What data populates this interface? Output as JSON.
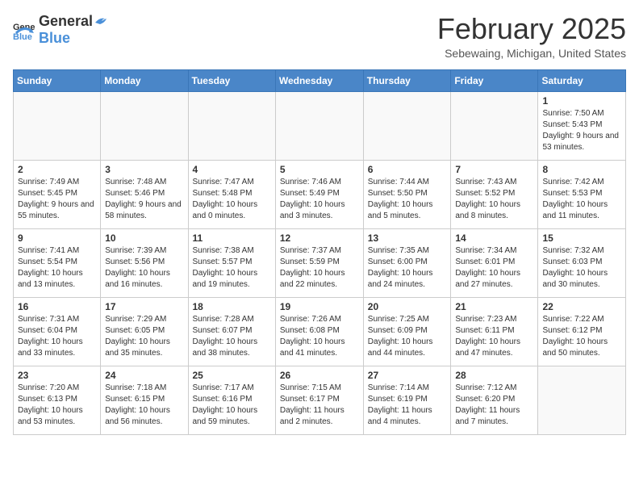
{
  "header": {
    "logo_general": "General",
    "logo_blue": "Blue",
    "title": "February 2025",
    "subtitle": "Sebewaing, Michigan, United States"
  },
  "columns": [
    "Sunday",
    "Monday",
    "Tuesday",
    "Wednesday",
    "Thursday",
    "Friday",
    "Saturday"
  ],
  "weeks": [
    [
      {
        "day": "",
        "info": ""
      },
      {
        "day": "",
        "info": ""
      },
      {
        "day": "",
        "info": ""
      },
      {
        "day": "",
        "info": ""
      },
      {
        "day": "",
        "info": ""
      },
      {
        "day": "",
        "info": ""
      },
      {
        "day": "1",
        "info": "Sunrise: 7:50 AM\nSunset: 5:43 PM\nDaylight: 9 hours and 53 minutes."
      }
    ],
    [
      {
        "day": "2",
        "info": "Sunrise: 7:49 AM\nSunset: 5:45 PM\nDaylight: 9 hours and 55 minutes."
      },
      {
        "day": "3",
        "info": "Sunrise: 7:48 AM\nSunset: 5:46 PM\nDaylight: 9 hours and 58 minutes."
      },
      {
        "day": "4",
        "info": "Sunrise: 7:47 AM\nSunset: 5:48 PM\nDaylight: 10 hours and 0 minutes."
      },
      {
        "day": "5",
        "info": "Sunrise: 7:46 AM\nSunset: 5:49 PM\nDaylight: 10 hours and 3 minutes."
      },
      {
        "day": "6",
        "info": "Sunrise: 7:44 AM\nSunset: 5:50 PM\nDaylight: 10 hours and 5 minutes."
      },
      {
        "day": "7",
        "info": "Sunrise: 7:43 AM\nSunset: 5:52 PM\nDaylight: 10 hours and 8 minutes."
      },
      {
        "day": "8",
        "info": "Sunrise: 7:42 AM\nSunset: 5:53 PM\nDaylight: 10 hours and 11 minutes."
      }
    ],
    [
      {
        "day": "9",
        "info": "Sunrise: 7:41 AM\nSunset: 5:54 PM\nDaylight: 10 hours and 13 minutes."
      },
      {
        "day": "10",
        "info": "Sunrise: 7:39 AM\nSunset: 5:56 PM\nDaylight: 10 hours and 16 minutes."
      },
      {
        "day": "11",
        "info": "Sunrise: 7:38 AM\nSunset: 5:57 PM\nDaylight: 10 hours and 19 minutes."
      },
      {
        "day": "12",
        "info": "Sunrise: 7:37 AM\nSunset: 5:59 PM\nDaylight: 10 hours and 22 minutes."
      },
      {
        "day": "13",
        "info": "Sunrise: 7:35 AM\nSunset: 6:00 PM\nDaylight: 10 hours and 24 minutes."
      },
      {
        "day": "14",
        "info": "Sunrise: 7:34 AM\nSunset: 6:01 PM\nDaylight: 10 hours and 27 minutes."
      },
      {
        "day": "15",
        "info": "Sunrise: 7:32 AM\nSunset: 6:03 PM\nDaylight: 10 hours and 30 minutes."
      }
    ],
    [
      {
        "day": "16",
        "info": "Sunrise: 7:31 AM\nSunset: 6:04 PM\nDaylight: 10 hours and 33 minutes."
      },
      {
        "day": "17",
        "info": "Sunrise: 7:29 AM\nSunset: 6:05 PM\nDaylight: 10 hours and 35 minutes."
      },
      {
        "day": "18",
        "info": "Sunrise: 7:28 AM\nSunset: 6:07 PM\nDaylight: 10 hours and 38 minutes."
      },
      {
        "day": "19",
        "info": "Sunrise: 7:26 AM\nSunset: 6:08 PM\nDaylight: 10 hours and 41 minutes."
      },
      {
        "day": "20",
        "info": "Sunrise: 7:25 AM\nSunset: 6:09 PM\nDaylight: 10 hours and 44 minutes."
      },
      {
        "day": "21",
        "info": "Sunrise: 7:23 AM\nSunset: 6:11 PM\nDaylight: 10 hours and 47 minutes."
      },
      {
        "day": "22",
        "info": "Sunrise: 7:22 AM\nSunset: 6:12 PM\nDaylight: 10 hours and 50 minutes."
      }
    ],
    [
      {
        "day": "23",
        "info": "Sunrise: 7:20 AM\nSunset: 6:13 PM\nDaylight: 10 hours and 53 minutes."
      },
      {
        "day": "24",
        "info": "Sunrise: 7:18 AM\nSunset: 6:15 PM\nDaylight: 10 hours and 56 minutes."
      },
      {
        "day": "25",
        "info": "Sunrise: 7:17 AM\nSunset: 6:16 PM\nDaylight: 10 hours and 59 minutes."
      },
      {
        "day": "26",
        "info": "Sunrise: 7:15 AM\nSunset: 6:17 PM\nDaylight: 11 hours and 2 minutes."
      },
      {
        "day": "27",
        "info": "Sunrise: 7:14 AM\nSunset: 6:19 PM\nDaylight: 11 hours and 4 minutes."
      },
      {
        "day": "28",
        "info": "Sunrise: 7:12 AM\nSunset: 6:20 PM\nDaylight: 11 hours and 7 minutes."
      },
      {
        "day": "",
        "info": ""
      }
    ]
  ]
}
